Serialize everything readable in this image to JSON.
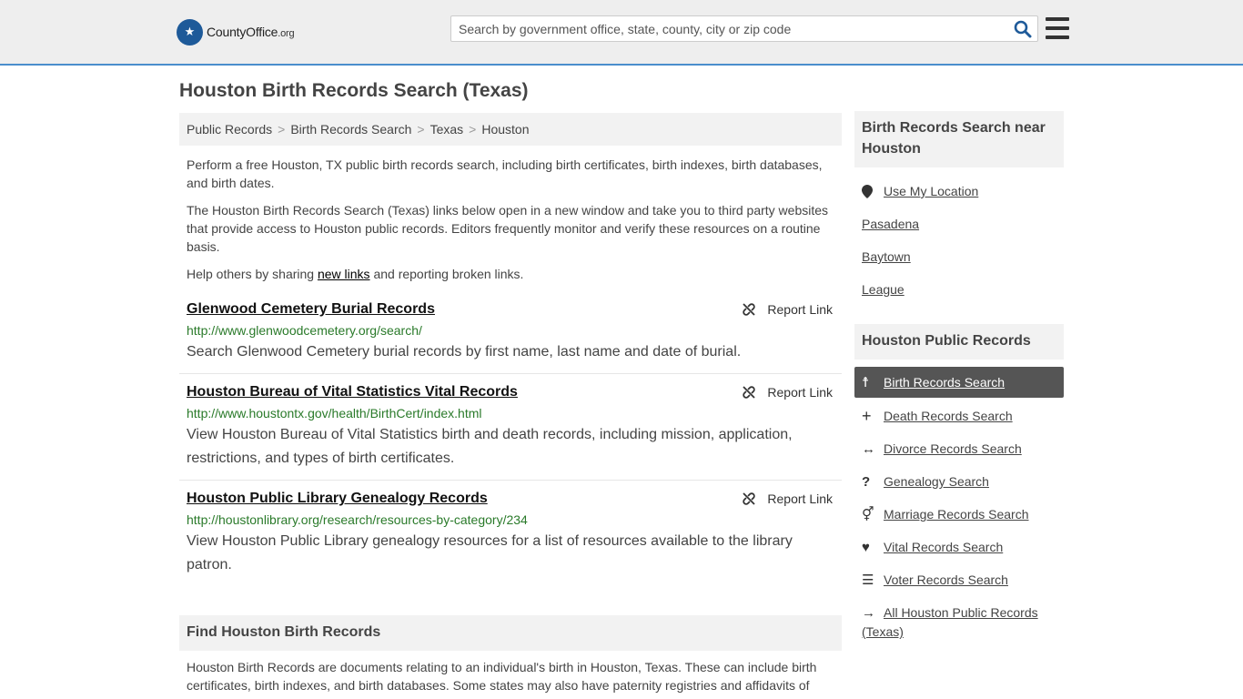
{
  "header": {
    "logo_main": "CountyOffice",
    "logo_domain": ".org",
    "search_placeholder": "Search by government office, state, county, city or zip code"
  },
  "page_title": "Houston Birth Records Search (Texas)",
  "breadcrumb": [
    "Public Records",
    "Birth Records Search",
    "Texas",
    "Houston"
  ],
  "intro": {
    "p1": "Perform a free Houston, TX public birth records search, including birth certificates, birth indexes, birth databases, and birth dates.",
    "p2": "The Houston Birth Records Search (Texas) links below open in a new window and take you to third party websites that provide access to Houston public records. Editors frequently monitor and verify these resources on a routine basis.",
    "p3_before": "Help others by sharing ",
    "p3_link": "new links",
    "p3_after": " and reporting broken links."
  },
  "report_label": "Report Link",
  "records": [
    {
      "title": "Glenwood Cemetery Burial Records",
      "url": "http://www.glenwoodcemetery.org/search/",
      "desc": "Search Glenwood Cemetery burial records by first name, last name and date of burial."
    },
    {
      "title": "Houston Bureau of Vital Statistics Vital Records",
      "url": "http://www.houstontx.gov/health/BirthCert/index.html",
      "desc": "View Houston Bureau of Vital Statistics birth and death records, including mission, application, restrictions, and types of birth certificates."
    },
    {
      "title": "Houston Public Library Genealogy Records",
      "url": "http://houstonlibrary.org/research/resources-by-category/234",
      "desc": "View Houston Public Library genealogy resources for a list of resources available to the library patron."
    }
  ],
  "find": {
    "heading": "Find Houston Birth Records",
    "text": "Houston Birth Records are documents relating to an individual's birth in Houston, Texas. These can include birth certificates, birth indexes, and birth databases. Some states may also have paternity registries and affidavits of"
  },
  "sidebar": {
    "near_heading": "Birth Records Search near Houston",
    "near_items": [
      {
        "label": "Use My Location",
        "icon": "map-pin-icon"
      },
      {
        "label": "Pasadena"
      },
      {
        "label": "Baytown"
      },
      {
        "label": "League"
      }
    ],
    "public_heading": "Houston Public Records",
    "public_items": [
      {
        "label": "Birth Records Search",
        "icon": "baby-icon",
        "active": true
      },
      {
        "label": "Death Records Search",
        "icon": "cross-icon"
      },
      {
        "label": "Divorce Records Search",
        "icon": "arrows-horizontal-icon"
      },
      {
        "label": "Genealogy Search",
        "icon": "question-icon"
      },
      {
        "label": "Marriage Records Search",
        "icon": "gender-icon"
      },
      {
        "label": "Vital Records Search",
        "icon": "heartbeat-icon"
      },
      {
        "label": "Voter Records Search",
        "icon": "list-icon"
      },
      {
        "label": "All Houston Public Records (Texas)",
        "icon": "arrow-right-icon"
      }
    ]
  }
}
